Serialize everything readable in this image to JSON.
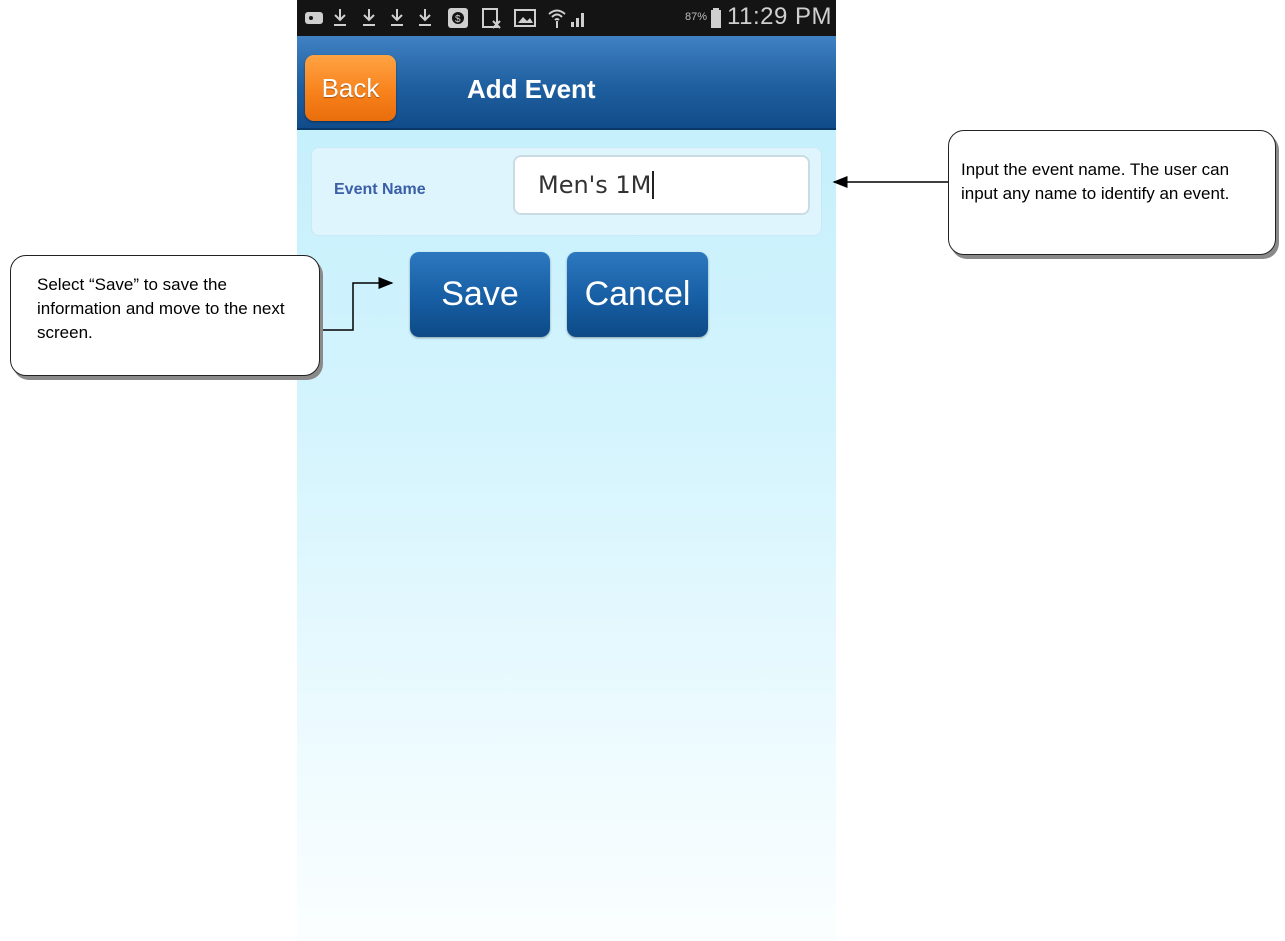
{
  "status_bar": {
    "icons": [
      "notification-icon",
      "download-icon",
      "download-icon",
      "download-icon",
      "download-icon",
      "app-badge-icon",
      "clipboard-icon",
      "gallery-icon",
      "wifi-icon",
      "signal-icon",
      "battery-icon"
    ],
    "battery_percent": "87%",
    "time": "11:29 PM"
  },
  "app_bar": {
    "back_label": "Back",
    "title": "Add Event"
  },
  "form": {
    "event_name_label": "Event Name",
    "event_name_value": "Men's 1M"
  },
  "actions": {
    "save_label": "Save",
    "cancel_label": "Cancel"
  },
  "annotations": {
    "event_name_note": "Input the event name.  The user can input any name to identify an event.",
    "save_note": "Select “Save” to save the information and move to the next screen."
  },
  "colors": {
    "app_bar": "#1f5f9f",
    "back_button": "#f7801a",
    "primary_button": "#175ea4",
    "background": "#bfeefc"
  }
}
